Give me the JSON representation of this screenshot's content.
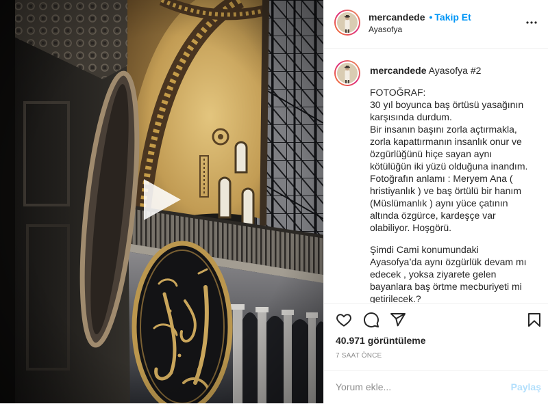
{
  "header": {
    "username": "mercandede",
    "separator": "•",
    "follow_label": "Takip Et",
    "location": "Ayasofya",
    "avatar_icon": "avatar",
    "more_icon": "more-horizontal-icon"
  },
  "media": {
    "play_icon": "play-icon"
  },
  "caption": {
    "username": "mercandede",
    "headline": "Ayasofya #2",
    "paragraphs": [
      [
        "FOTOĞRAF:",
        "30 yıl boyunca baş örtüsü yasağının",
        "karşısında durdum.",
        "Bir insanın başını zorla açtırmakla,",
        "zorla kapattırmanın insanlık onur ve",
        "özgürlüğünü hiçe sayan aynı",
        "kötülüğün iki yüzü olduğuna inandım.",
        "Fotoğrafın anlamı : Meryem Ana (",
        "hristiyanlık ) ve baş örtülü bir hanım",
        "(Müslümanlık ) aynı yüce çatının",
        "altında özgürce, kardeşçe var",
        "olabiliyor. Hoşgörü."
      ],
      [
        "Şimdi Cami konumundaki",
        "Ayasofya’da aynı özgürlük devam mı",
        "edecek , yoksa ziyarete gelen",
        "bayanlara baş örtme mecburiyeti mi",
        "getirilecek.?"
      ]
    ]
  },
  "actions": {
    "like_icon": "heart-icon",
    "comment_icon": "comment-icon",
    "share_icon": "share-icon",
    "save_icon": "bookmark-icon"
  },
  "stats": {
    "views": "40.971 görüntüleme",
    "time": "7 SAAT ÖNCE"
  },
  "comment_box": {
    "placeholder": "Yorum ekle...",
    "submit_label": "Paylaş"
  },
  "colors": {
    "text": "#262626",
    "link": "#0095f6",
    "muted": "#8e8e8e",
    "submit": "#b2dffc",
    "border": "#efefef"
  }
}
